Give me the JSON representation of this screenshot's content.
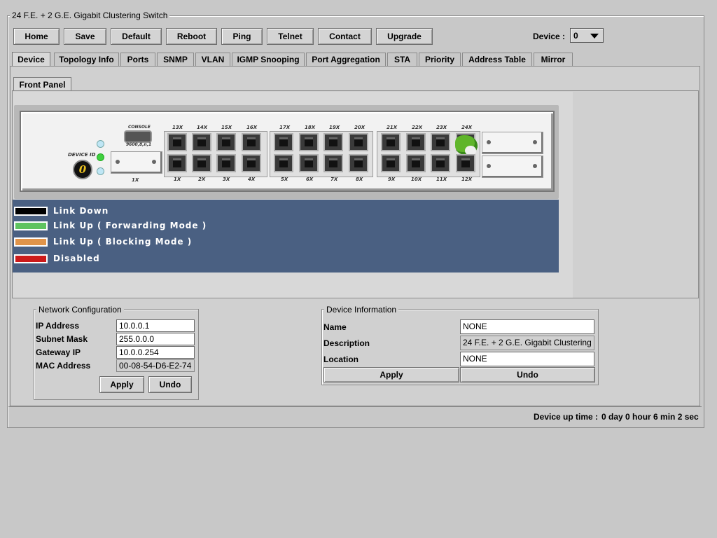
{
  "window": {
    "title": "24 F.E. + 2 G.E. Gigabit Clustering Switch"
  },
  "toolbar": {
    "buttons": [
      "Home",
      "Save",
      "Default",
      "Reboot",
      "Ping",
      "Telnet",
      "Contact",
      "Upgrade"
    ],
    "device_label": "Device :",
    "device_value": "0"
  },
  "tabs": [
    "Device",
    "Topology Info",
    "Ports",
    "SNMP",
    "VLAN",
    "IGMP Snooping",
    "Port Aggregation",
    "STA",
    "Priority",
    "Address Table",
    "Mirror"
  ],
  "active_tab": "Device",
  "subtab": "Front Panel",
  "front_panel": {
    "console_label": "CONSOLE",
    "console_sub": "9600,8,n,1",
    "device_id_label": "DEVICE ID",
    "device_id_value": "0",
    "top_ports": [
      "13X",
      "14X",
      "15X",
      "16X",
      "17X",
      "18X",
      "19X",
      "20X",
      "21X",
      "22X",
      "23X",
      "24X"
    ],
    "bottom_ports": [
      "1X",
      "2X",
      "3X",
      "4X",
      "5X",
      "6X",
      "7X",
      "8X",
      "9X",
      "10X",
      "11X",
      "12X"
    ],
    "sfp_label": "1X",
    "linked_port": "24X"
  },
  "legend": [
    {
      "text": "Link Down",
      "color": "#000000"
    },
    {
      "text": "Link Up ( Forwarding Mode )",
      "color": "#5fc35f"
    },
    {
      "text": "Link Up ( Blocking Mode )",
      "color": "#e0944a"
    },
    {
      "text": "Disabled",
      "color": "#cc1a1a"
    }
  ],
  "network_config": {
    "title": "Network Configuration",
    "ip_label": "IP Address",
    "ip_value": "10.0.0.1",
    "mask_label": "Subnet Mask",
    "mask_value": "255.0.0.0",
    "gateway_label": "Gateway IP",
    "gateway_value": "10.0.0.254",
    "mac_label": "MAC Address",
    "mac_value": "00-08-54-D6-E2-74",
    "apply": "Apply",
    "undo": "Undo"
  },
  "device_info": {
    "title": "Device Information",
    "name_label": "Name",
    "name_value": "NONE",
    "desc_label": "Description",
    "desc_value": "24 F.E. + 2 G.E. Gigabit Clustering",
    "loc_label": "Location",
    "loc_value": "NONE",
    "apply": "Apply",
    "undo": "Undo"
  },
  "status": {
    "uptime_label": "Device up time :",
    "uptime_value": "0 day 0 hour 6 min 2 sec"
  },
  "colors": {
    "legend_bg": "#4a6082",
    "panel_bg": "#d0d0d0",
    "window_bg": "#c8c8c8"
  }
}
